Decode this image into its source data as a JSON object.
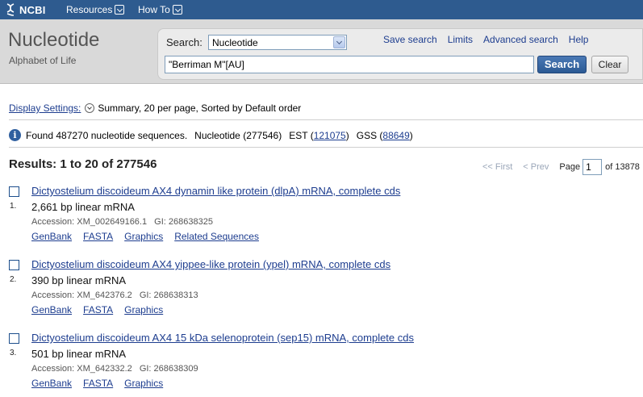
{
  "topbar": {
    "logo_text": "NCBI",
    "nav": [
      {
        "label": "Resources"
      },
      {
        "label": "How To"
      }
    ]
  },
  "header": {
    "db_title": "Nucleotide",
    "db_subtitle": "Alphabet of Life"
  },
  "search": {
    "label": "Search:",
    "database": "Nucleotide",
    "query": "\"Berriman M\"[AU]",
    "search_button": "Search",
    "clear_button": "Clear",
    "links": [
      "Save search",
      "Limits",
      "Advanced search",
      "Help"
    ]
  },
  "display": {
    "settings_link": "Display Settings:",
    "settings_text": "Summary, 20 per page, Sorted by Default order"
  },
  "found": {
    "text": "Found 487270 nucleotide sequences.",
    "nucleotide_text": "Nucleotide (277546)",
    "est_label": "EST (",
    "est_count": "121075",
    "gss_label": "GSS (",
    "gss_count": "88649",
    "close_paren": ")"
  },
  "results": {
    "title": "Results: 1 to 20 of 277546",
    "pager": {
      "first": "<< First",
      "prev": "< Prev",
      "page_label": "Page",
      "page_value": "1",
      "of_text": "of 13878"
    },
    "items": [
      {
        "num": "1.",
        "title": "Dictyostelium discoideum AX4 dynamin like protein (dlpA) mRNA, complete cds",
        "desc": "2,661 bp linear mRNA",
        "accession": "Accession: XM_002649166.1",
        "gi": "GI: 268638325",
        "links": [
          "GenBank",
          "FASTA",
          "Graphics",
          "Related Sequences"
        ]
      },
      {
        "num": "2.",
        "title": "Dictyostelium discoideum AX4 yippee-like protein (ypel) mRNA, complete cds",
        "desc": "390 bp linear mRNA",
        "accession": "Accession: XM_642376.2",
        "gi": "GI: 268638313",
        "links": [
          "GenBank",
          "FASTA",
          "Graphics"
        ]
      },
      {
        "num": "3.",
        "title": "Dictyostelium discoideum AX4 15 kDa selenoprotein (sep15) mRNA, complete cds",
        "desc": "501 bp linear mRNA",
        "accession": "Accession: XM_642332.2",
        "gi": "GI: 268638309",
        "links": [
          "GenBank",
          "FASTA",
          "Graphics"
        ]
      }
    ]
  },
  "colors": {
    "topbar_bg": "#2e5b8f",
    "header_bg": "#d9d9d9",
    "link": "#1d3d8f"
  }
}
